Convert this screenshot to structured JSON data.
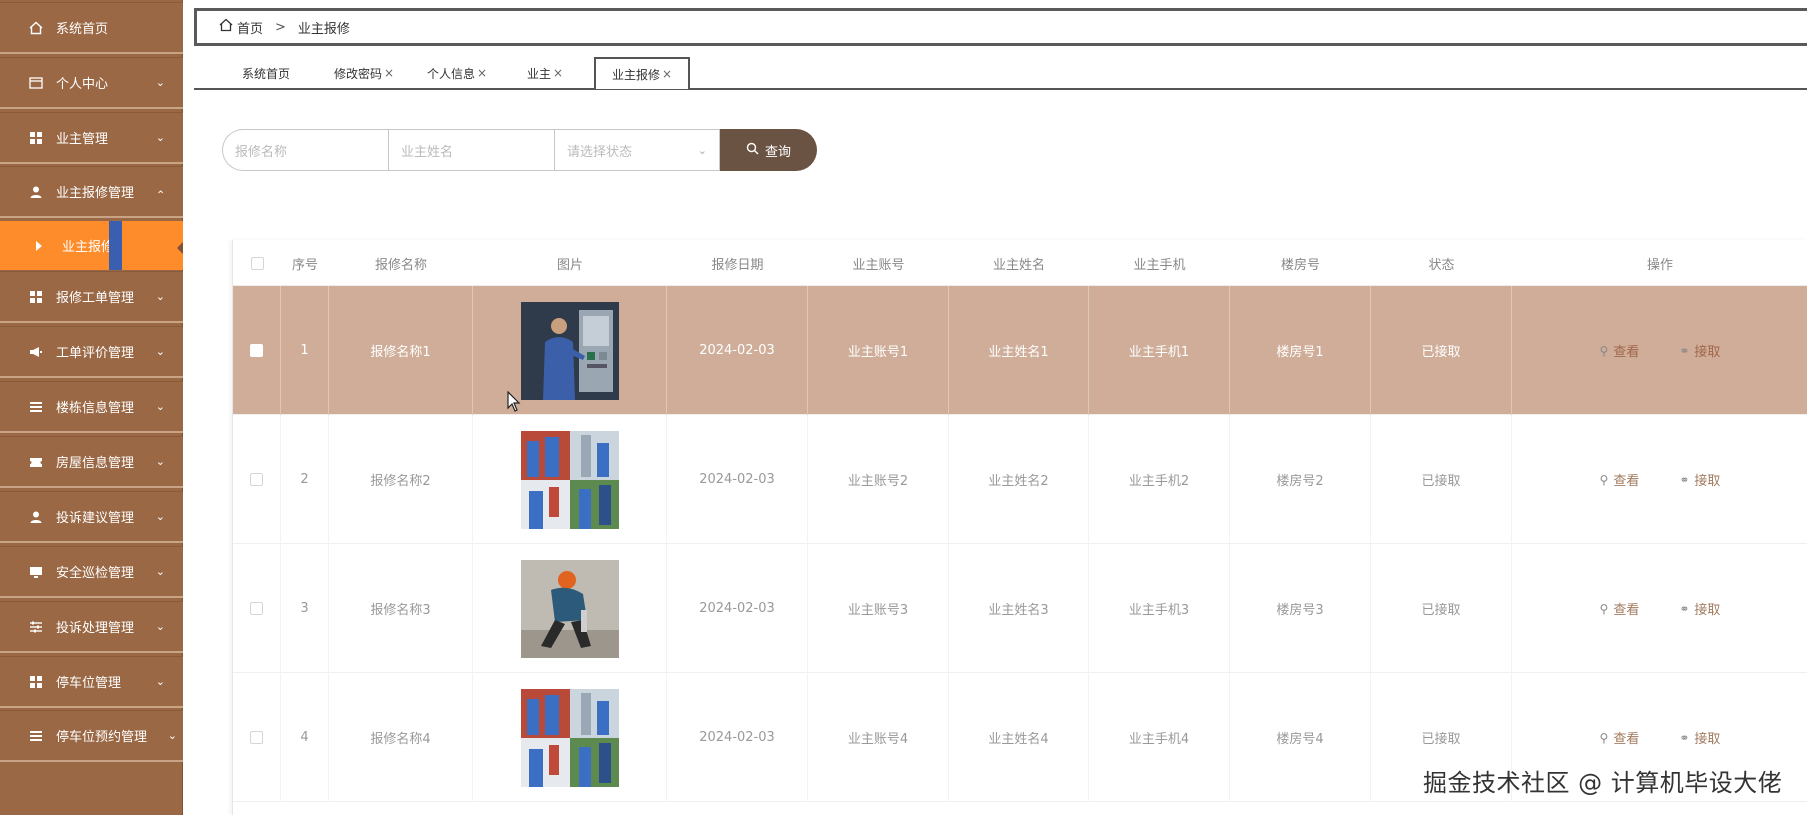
{
  "sidebar": {
    "items": [
      {
        "label": "系统首页",
        "icon": "home-icon",
        "has_chevron": false
      },
      {
        "label": "个人中心",
        "icon": "card-icon",
        "has_chevron": true
      },
      {
        "label": "业主管理",
        "icon": "grid-icon",
        "has_chevron": true
      },
      {
        "label": "业主报修管理",
        "icon": "user-icon",
        "has_chevron": true,
        "expanded": true
      },
      {
        "label": "业主报修",
        "sub": true,
        "active": true
      },
      {
        "label": "报修工单管理",
        "icon": "grid-icon",
        "has_chevron": true
      },
      {
        "label": "工单评价管理",
        "icon": "megaphone-icon",
        "has_chevron": true
      },
      {
        "label": "楼栋信息管理",
        "icon": "list-icon",
        "has_chevron": true
      },
      {
        "label": "房屋信息管理",
        "icon": "ticket-icon",
        "has_chevron": true
      },
      {
        "label": "投诉建议管理",
        "icon": "user-icon",
        "has_chevron": true
      },
      {
        "label": "安全巡检管理",
        "icon": "monitor-icon",
        "has_chevron": true
      },
      {
        "label": "投诉处理管理",
        "icon": "sliders-icon",
        "has_chevron": true
      },
      {
        "label": "停车位管理",
        "icon": "grid-icon",
        "has_chevron": true
      },
      {
        "label": "停车位预约管理",
        "icon": "list-icon",
        "has_chevron": true
      }
    ]
  },
  "breadcrumb": {
    "home": "首页",
    "separator": ">",
    "current": "业主报修"
  },
  "tabs": [
    {
      "label": "系统首页",
      "closable": false
    },
    {
      "label": "修改密码",
      "closable": true
    },
    {
      "label": "个人信息",
      "closable": true
    },
    {
      "label": "业主",
      "closable": true
    },
    {
      "label": "业主报修",
      "closable": true,
      "current": true
    }
  ],
  "tab_close_glyph": "×",
  "search": {
    "field1_placeholder": "报修名称",
    "field2_placeholder": "业主姓名",
    "status_placeholder": "请选择状态",
    "button_label": "查询"
  },
  "table": {
    "headers": [
      "序号",
      "报修名称",
      "图片",
      "报修日期",
      "业主账号",
      "业主姓名",
      "业主手机",
      "楼房号",
      "状态",
      "操作"
    ],
    "rows": [
      {
        "index": "1",
        "name": "报修名称1",
        "image": "technician-at-panel",
        "date": "2024-02-03",
        "account": "业主账号1",
        "owner": "业主姓名1",
        "phone": "业主手机1",
        "room": "楼房号1",
        "status": "已接取",
        "highlighted": true
      },
      {
        "index": "2",
        "name": "报修名称2",
        "image": "workers-collage",
        "date": "2024-02-03",
        "account": "业主账号2",
        "owner": "业主姓名2",
        "phone": "业主手机2",
        "room": "楼房号2",
        "status": "已接取",
        "highlighted": false
      },
      {
        "index": "3",
        "name": "报修名称3",
        "image": "worker-repairing-road",
        "date": "2024-02-03",
        "account": "业主账号3",
        "owner": "业主姓名3",
        "phone": "业主手机3",
        "room": "楼房号3",
        "status": "已接取",
        "highlighted": false
      },
      {
        "index": "4",
        "name": "报修名称4",
        "image": "workers-collage",
        "date": "2024-02-03",
        "account": "业主账号4",
        "owner": "业主姓名4",
        "phone": "业主手机4",
        "room": "楼房号4",
        "status": "已接取",
        "highlighted": false
      }
    ],
    "actions": {
      "view": "查看",
      "accept": "接取"
    }
  },
  "watermark": "掘金技术社区 @ 计算机毕设大佬",
  "colors": {
    "sidebar_bg": "#9b6845",
    "active_sub_bg": "#ff8c2a",
    "highlight_row": "#cfad99",
    "search_button": "#6b5343"
  }
}
